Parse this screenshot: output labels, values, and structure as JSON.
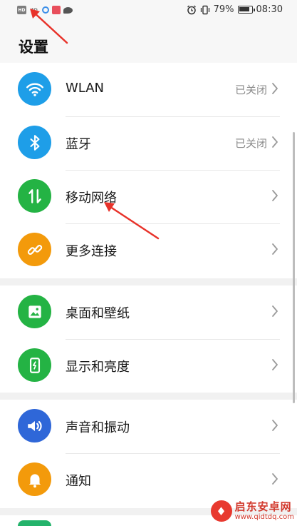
{
  "status_bar": {
    "hd_label": "HD",
    "signal_label": "4G",
    "battery_text": "79%",
    "time": "08:30"
  },
  "page": {
    "title": "设置"
  },
  "groups": [
    {
      "items": [
        {
          "label": "WLAN",
          "value": "已关闭",
          "icon": "wifi-icon",
          "color": "#1e9ee8"
        },
        {
          "label": "蓝牙",
          "value": "已关闭",
          "icon": "bluetooth-icon",
          "color": "#1e9ee8"
        },
        {
          "label": "移动网络",
          "value": "",
          "icon": "mobile-data-icon",
          "color": "#24b344"
        },
        {
          "label": "更多连接",
          "value": "",
          "icon": "link-icon",
          "color": "#f39a0b"
        }
      ]
    },
    {
      "items": [
        {
          "label": "桌面和壁纸",
          "value": "",
          "icon": "wallpaper-icon",
          "color": "#24b344"
        },
        {
          "label": "显示和亮度",
          "value": "",
          "icon": "display-icon",
          "color": "#24b344"
        }
      ]
    },
    {
      "items": [
        {
          "label": "声音和振动",
          "value": "",
          "icon": "sound-icon",
          "color": "#2f67d8"
        },
        {
          "label": "通知",
          "value": "",
          "icon": "notification-icon",
          "color": "#f39a0b"
        }
      ]
    }
  ],
  "watermark": {
    "title": "启东安卓网",
    "url": "www.qidtdq.com"
  }
}
